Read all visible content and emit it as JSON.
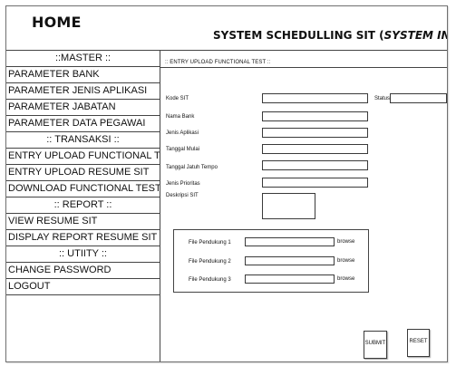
{
  "header": {
    "home_label": "HOME",
    "title_prefix": "SYSTEM SCHEDULLING SIT (",
    "title_italic": "SYSTEM INTEGRATION TEST",
    "title_suffix": ")"
  },
  "sidebar": {
    "items": [
      {
        "label": "::MASTER ::",
        "type": "section"
      },
      {
        "label": "PARAMETER BANK",
        "type": "link"
      },
      {
        "label": "PARAMETER JENIS APLIKASI",
        "type": "link"
      },
      {
        "label": "PARAMETER JABATAN",
        "type": "link"
      },
      {
        "label": "PARAMETER DATA PEGAWAI",
        "type": "link"
      },
      {
        "label": ":: TRANSAKSI ::",
        "type": "section"
      },
      {
        "label": "ENTRY UPLOAD FUNCTIONAL TEST",
        "type": "link"
      },
      {
        "label": "ENTRY UPLOAD RESUME SIT",
        "type": "link"
      },
      {
        "label": "DOWNLOAD FUNCTIONAL TEST",
        "type": "link"
      },
      {
        "label": ":: REPORT ::",
        "type": "section"
      },
      {
        "label": "VIEW RESUME SIT",
        "type": "link"
      },
      {
        "label": "DISPLAY REPORT RESUME SIT",
        "type": "link"
      },
      {
        "label": ":: UTIITY ::",
        "type": "section"
      },
      {
        "label": "CHANGE PASSWORD",
        "type": "link"
      },
      {
        "label": "LOGOUT",
        "type": "link"
      }
    ]
  },
  "main": {
    "section_title": ":: ENTRY UPLOAD FUNCTIONAL TEST ::",
    "fields": {
      "kode_sit_label": "Kode SIT",
      "status_label": "Status",
      "nama_bank_label": "Nama Bank",
      "jenis_aplikasi_label": "Jenis Aplikasi",
      "tanggal_mulai_label": "Tanggal Mulai",
      "tanggal_jatuh_tempo_label": "Tanggal Jatuh Tempo",
      "jenis_prioritas_label": "Jenis Prioritas",
      "deskripsi_sit_label": "Deskripsi SIT"
    },
    "upload": {
      "file1_label": "File Pendukung 1",
      "file2_label": "File Pendukung 2",
      "file3_label": "File Pendukung 3",
      "browse_label": "browse"
    },
    "buttons": {
      "submit_label": "SUBMIT",
      "reset_label": "RESET"
    }
  }
}
